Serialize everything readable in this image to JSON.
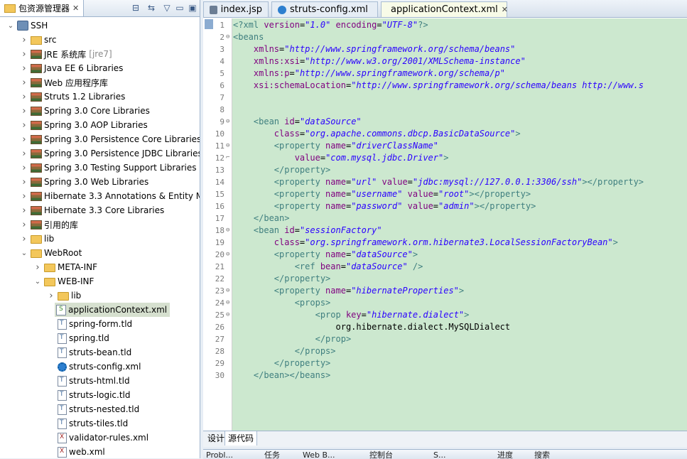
{
  "explorer": {
    "tab_label": "包资源管理器",
    "tree": [
      {
        "label": "SSH",
        "depth": 0,
        "expanded": true,
        "icon": "project-icon"
      },
      {
        "label": "src",
        "depth": 1,
        "expanded": false,
        "icon": "source-folder-icon"
      },
      {
        "label": "JRE 系统库",
        "suffix": "[jre7]",
        "depth": 1,
        "expanded": false,
        "icon": "library-icon"
      },
      {
        "label": "Java EE 6 Libraries",
        "depth": 1,
        "expanded": false,
        "icon": "library-icon"
      },
      {
        "label": "Web 应用程序库",
        "depth": 1,
        "expanded": false,
        "icon": "library-icon"
      },
      {
        "label": "Struts 1.2 Libraries",
        "depth": 1,
        "expanded": false,
        "icon": "library-icon"
      },
      {
        "label": "Spring 3.0 Core Libraries",
        "depth": 1,
        "expanded": false,
        "icon": "library-icon"
      },
      {
        "label": "Spring 3.0 AOP Libraries",
        "depth": 1,
        "expanded": false,
        "icon": "library-icon"
      },
      {
        "label": "Spring 3.0 Persistence Core Libraries",
        "depth": 1,
        "expanded": false,
        "icon": "library-icon"
      },
      {
        "label": "Spring 3.0 Persistence JDBC Libraries",
        "depth": 1,
        "expanded": false,
        "icon": "library-icon"
      },
      {
        "label": "Spring 3.0 Testing Support Libraries",
        "depth": 1,
        "expanded": false,
        "icon": "library-icon"
      },
      {
        "label": "Spring 3.0 Web Libraries",
        "depth": 1,
        "expanded": false,
        "icon": "library-icon"
      },
      {
        "label": "Hibernate 3.3 Annotations & Entity M",
        "depth": 1,
        "expanded": false,
        "icon": "library-icon"
      },
      {
        "label": "Hibernate 3.3 Core Libraries",
        "depth": 1,
        "expanded": false,
        "icon": "library-icon"
      },
      {
        "label": "引用的库",
        "depth": 1,
        "expanded": false,
        "icon": "library-icon"
      },
      {
        "label": "lib",
        "depth": 1,
        "expanded": false,
        "icon": "folder-icon"
      },
      {
        "label": "WebRoot",
        "depth": 1,
        "expanded": true,
        "icon": "folder-icon"
      },
      {
        "label": "META-INF",
        "depth": 2,
        "expanded": false,
        "icon": "folder-icon"
      },
      {
        "label": "WEB-INF",
        "depth": 2,
        "expanded": true,
        "icon": "folder-icon"
      },
      {
        "label": "lib",
        "depth": 3,
        "expanded": false,
        "icon": "folder-icon"
      },
      {
        "label": "applicationContext.xml",
        "depth": 3,
        "leaf": true,
        "selected": true,
        "icon": "spring-xml-icon"
      },
      {
        "label": "spring-form.tld",
        "depth": 3,
        "leaf": true,
        "icon": "tld-file-icon"
      },
      {
        "label": "spring.tld",
        "depth": 3,
        "leaf": true,
        "icon": "tld-file-icon"
      },
      {
        "label": "struts-bean.tld",
        "depth": 3,
        "leaf": true,
        "icon": "tld-file-icon"
      },
      {
        "label": "struts-config.xml",
        "depth": 3,
        "leaf": true,
        "icon": "gear-icon"
      },
      {
        "label": "struts-html.tld",
        "depth": 3,
        "leaf": true,
        "icon": "tld-file-icon"
      },
      {
        "label": "struts-logic.tld",
        "depth": 3,
        "leaf": true,
        "icon": "tld-file-icon"
      },
      {
        "label": "struts-nested.tld",
        "depth": 3,
        "leaf": true,
        "icon": "tld-file-icon"
      },
      {
        "label": "struts-tiles.tld",
        "depth": 3,
        "leaf": true,
        "icon": "tld-file-icon"
      },
      {
        "label": "validator-rules.xml",
        "depth": 3,
        "leaf": true,
        "icon": "xml-file-icon"
      },
      {
        "label": "web.xml",
        "depth": 3,
        "leaf": true,
        "icon": "xml-file-icon"
      }
    ]
  },
  "editor": {
    "tabs": [
      {
        "label": "index.jsp",
        "icon": "jsp-file-icon",
        "active": false
      },
      {
        "label": "struts-config.xml",
        "icon": "gear-icon",
        "active": false
      },
      {
        "label": "applicationContext.xml",
        "icon": "spring-xml-icon",
        "active": true,
        "closable": true
      }
    ],
    "lines": [
      [
        [
          "tg",
          "<?xml "
        ],
        [
          "at",
          "version"
        ],
        [
          "tx",
          "="
        ],
        [
          "vl",
          "\"1.0\""
        ],
        [
          "tx",
          " "
        ],
        [
          "at",
          "encoding"
        ],
        [
          "tx",
          "="
        ],
        [
          "vl",
          "\"UTF-8\""
        ],
        [
          "tg",
          "?>"
        ]
      ],
      [
        [
          "tg",
          "<beans"
        ]
      ],
      [
        [
          "tx",
          "    "
        ],
        [
          "at",
          "xmlns"
        ],
        [
          "tx",
          "="
        ],
        [
          "vl",
          "\"http://www.springframework.org/schema/beans\""
        ]
      ],
      [
        [
          "tx",
          "    "
        ],
        [
          "at",
          "xmlns:xsi"
        ],
        [
          "tx",
          "="
        ],
        [
          "vl",
          "\"http://www.w3.org/2001/XMLSchema-instance\""
        ]
      ],
      [
        [
          "tx",
          "    "
        ],
        [
          "at",
          "xmlns:p"
        ],
        [
          "tx",
          "="
        ],
        [
          "vl",
          "\"http://www.springframework.org/schema/p\""
        ]
      ],
      [
        [
          "tx",
          "    "
        ],
        [
          "at",
          "xsi:schemaLocation"
        ],
        [
          "tx",
          "="
        ],
        [
          "vl",
          "\"http://www.springframework.org/schema/beans http://www.s"
        ]
      ],
      [],
      [],
      [
        [
          "tx",
          "    "
        ],
        [
          "tg",
          "<bean "
        ],
        [
          "at",
          "id"
        ],
        [
          "tx",
          "="
        ],
        [
          "vl",
          "\"dataSource\""
        ]
      ],
      [
        [
          "tx",
          "        "
        ],
        [
          "at",
          "class"
        ],
        [
          "tx",
          "="
        ],
        [
          "vl",
          "\"org.apache.commons.dbcp.BasicDataSource\""
        ],
        [
          "tg",
          ">"
        ]
      ],
      [
        [
          "tx",
          "        "
        ],
        [
          "tg",
          "<property "
        ],
        [
          "at",
          "name"
        ],
        [
          "tx",
          "="
        ],
        [
          "vl",
          "\"driverClassName\""
        ]
      ],
      [
        [
          "tx",
          "            "
        ],
        [
          "at",
          "value"
        ],
        [
          "tx",
          "="
        ],
        [
          "vl",
          "\"com.mysql.jdbc.Driver\""
        ],
        [
          "tg",
          ">"
        ]
      ],
      [
        [
          "tx",
          "        "
        ],
        [
          "tg",
          "</property>"
        ]
      ],
      [
        [
          "tx",
          "        "
        ],
        [
          "tg",
          "<property "
        ],
        [
          "at",
          "name"
        ],
        [
          "tx",
          "="
        ],
        [
          "vl",
          "\"url\""
        ],
        [
          "tx",
          " "
        ],
        [
          "at",
          "value"
        ],
        [
          "tx",
          "="
        ],
        [
          "vl",
          "\"jdbc:mysql://127.0.0.1:3306/ssh\""
        ],
        [
          "tg",
          "></property>"
        ]
      ],
      [
        [
          "tx",
          "        "
        ],
        [
          "tg",
          "<property "
        ],
        [
          "at",
          "name"
        ],
        [
          "tx",
          "="
        ],
        [
          "vl",
          "\"username\""
        ],
        [
          "tx",
          " "
        ],
        [
          "at",
          "value"
        ],
        [
          "tx",
          "="
        ],
        [
          "vl",
          "\"root\""
        ],
        [
          "tg",
          "></property>"
        ]
      ],
      [
        [
          "tx",
          "        "
        ],
        [
          "tg",
          "<property "
        ],
        [
          "at",
          "name"
        ],
        [
          "tx",
          "="
        ],
        [
          "vl",
          "\"password\""
        ],
        [
          "tx",
          " "
        ],
        [
          "at",
          "value"
        ],
        [
          "tx",
          "="
        ],
        [
          "vl",
          "\"admin\""
        ],
        [
          "tg",
          "></property>"
        ]
      ],
      [
        [
          "tx",
          "    "
        ],
        [
          "tg",
          "</bean>"
        ]
      ],
      [
        [
          "tx",
          "    "
        ],
        [
          "tg",
          "<bean "
        ],
        [
          "at",
          "id"
        ],
        [
          "tx",
          "="
        ],
        [
          "vl",
          "\"sessionFactory\""
        ]
      ],
      [
        [
          "tx",
          "        "
        ],
        [
          "at",
          "class"
        ],
        [
          "tx",
          "="
        ],
        [
          "vl",
          "\"org.springframework.orm.hibernate3.LocalSessionFactoryBean\""
        ],
        [
          "tg",
          ">"
        ]
      ],
      [
        [
          "tx",
          "        "
        ],
        [
          "tg",
          "<property "
        ],
        [
          "at",
          "name"
        ],
        [
          "tx",
          "="
        ],
        [
          "vl",
          "\"dataSource\""
        ],
        [
          "tg",
          ">"
        ]
      ],
      [
        [
          "tx",
          "            "
        ],
        [
          "tg",
          "<ref "
        ],
        [
          "at",
          "bean"
        ],
        [
          "tx",
          "="
        ],
        [
          "vl",
          "\"dataSource\""
        ],
        [
          "tg",
          " />"
        ]
      ],
      [
        [
          "tx",
          "        "
        ],
        [
          "tg",
          "</property>"
        ]
      ],
      [
        [
          "tx",
          "        "
        ],
        [
          "tg",
          "<property "
        ],
        [
          "at",
          "name"
        ],
        [
          "tx",
          "="
        ],
        [
          "vl",
          "\"hibernateProperties\""
        ],
        [
          "tg",
          ">"
        ]
      ],
      [
        [
          "tx",
          "            "
        ],
        [
          "tg",
          "<props>"
        ]
      ],
      [
        [
          "tx",
          "                "
        ],
        [
          "tg",
          "<prop "
        ],
        [
          "at",
          "key"
        ],
        [
          "tx",
          "="
        ],
        [
          "vl",
          "\"hibernate.dialect\""
        ],
        [
          "tg",
          ">"
        ]
      ],
      [
        [
          "tx",
          "                    org.hibernate.dialect.MySQLDialect"
        ]
      ],
      [
        [
          "tx",
          "                "
        ],
        [
          "tg",
          "</prop>"
        ]
      ],
      [
        [
          "tx",
          "            "
        ],
        [
          "tg",
          "</props>"
        ]
      ],
      [
        [
          "tx",
          "        "
        ],
        [
          "tg",
          "</property>"
        ]
      ],
      [
        [
          "tx",
          "    "
        ],
        [
          "tg",
          "</bean></beans>"
        ]
      ]
    ],
    "fold_lines": [
      2,
      9,
      11,
      18,
      20,
      23,
      24,
      25
    ],
    "fold_end_lines": [
      12
    ],
    "source_tabs": [
      "设计",
      "源代码"
    ],
    "active_source_tab": 1
  },
  "bottom_panel": {
    "tabs": [
      "Probl...",
      "任务",
      "Web B...",
      "控制台",
      "S...",
      "进度",
      "搜索"
    ]
  }
}
